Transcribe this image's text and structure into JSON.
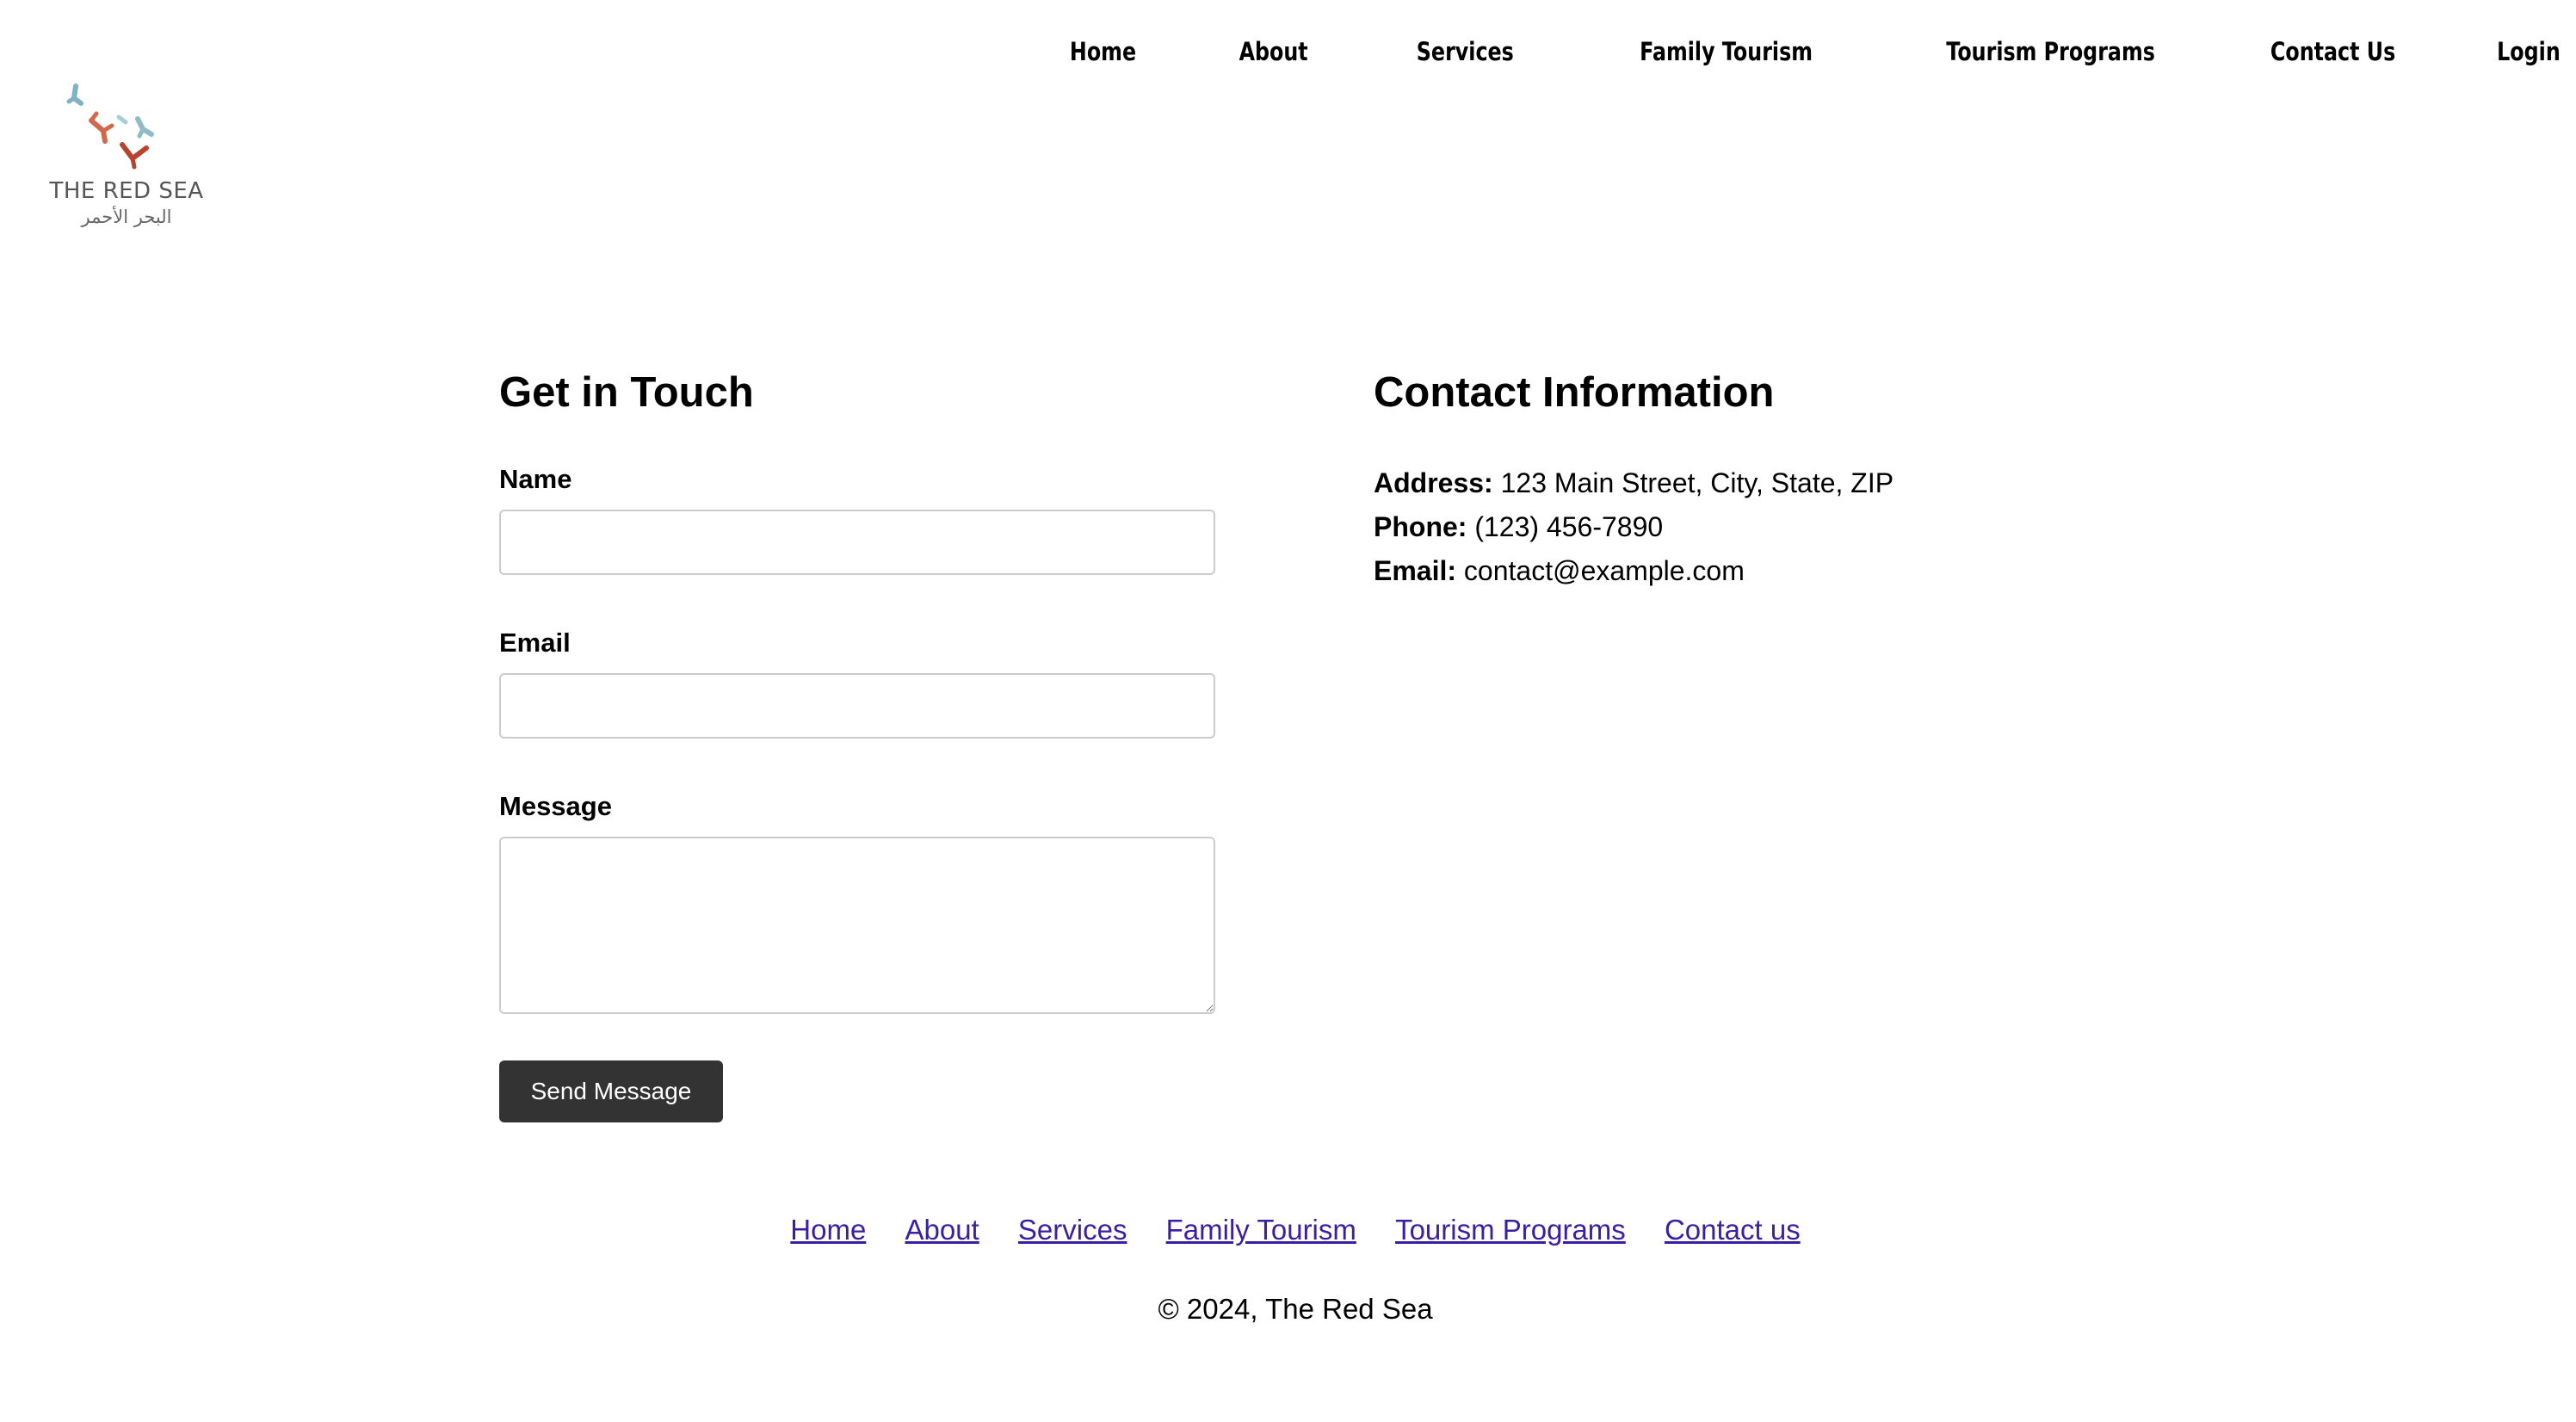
{
  "logo": {
    "name_en": "THE RED SEA",
    "name_ar": "البحر الأحمر"
  },
  "nav": {
    "items": [
      {
        "label": "Home"
      },
      {
        "label": "About"
      },
      {
        "label": "Services"
      },
      {
        "label": "Family Tourism"
      },
      {
        "label": "Tourism Programs"
      },
      {
        "label": "Contact Us"
      },
      {
        "label": "Login"
      }
    ]
  },
  "form": {
    "title": "Get in Touch",
    "name_label": "Name",
    "name_value": "",
    "email_label": "Email",
    "email_value": "",
    "message_label": "Message",
    "message_value": "",
    "submit_label": "Send Message"
  },
  "contact": {
    "title": "Contact Information",
    "address_label": "Address:",
    "address_value": "123 Main Street, City, State, ZIP",
    "phone_label": "Phone:",
    "phone_value": "(123) 456-7890",
    "email_label": "Email:",
    "email_value": "contact@example.com"
  },
  "footer": {
    "links": [
      {
        "label": "Home"
      },
      {
        "label": "About"
      },
      {
        "label": "Services"
      },
      {
        "label": "Family Tourism"
      },
      {
        "label": "Tourism Programs"
      },
      {
        "label": "Contact us"
      }
    ],
    "copyright": "© 2024, The Red Sea"
  },
  "colors": {
    "button_bg": "#333333",
    "link": "#3b1fa3",
    "coral_teal": "#7fb3c4",
    "coral_orange": "#d2694a",
    "coral_red": "#b8442e"
  }
}
